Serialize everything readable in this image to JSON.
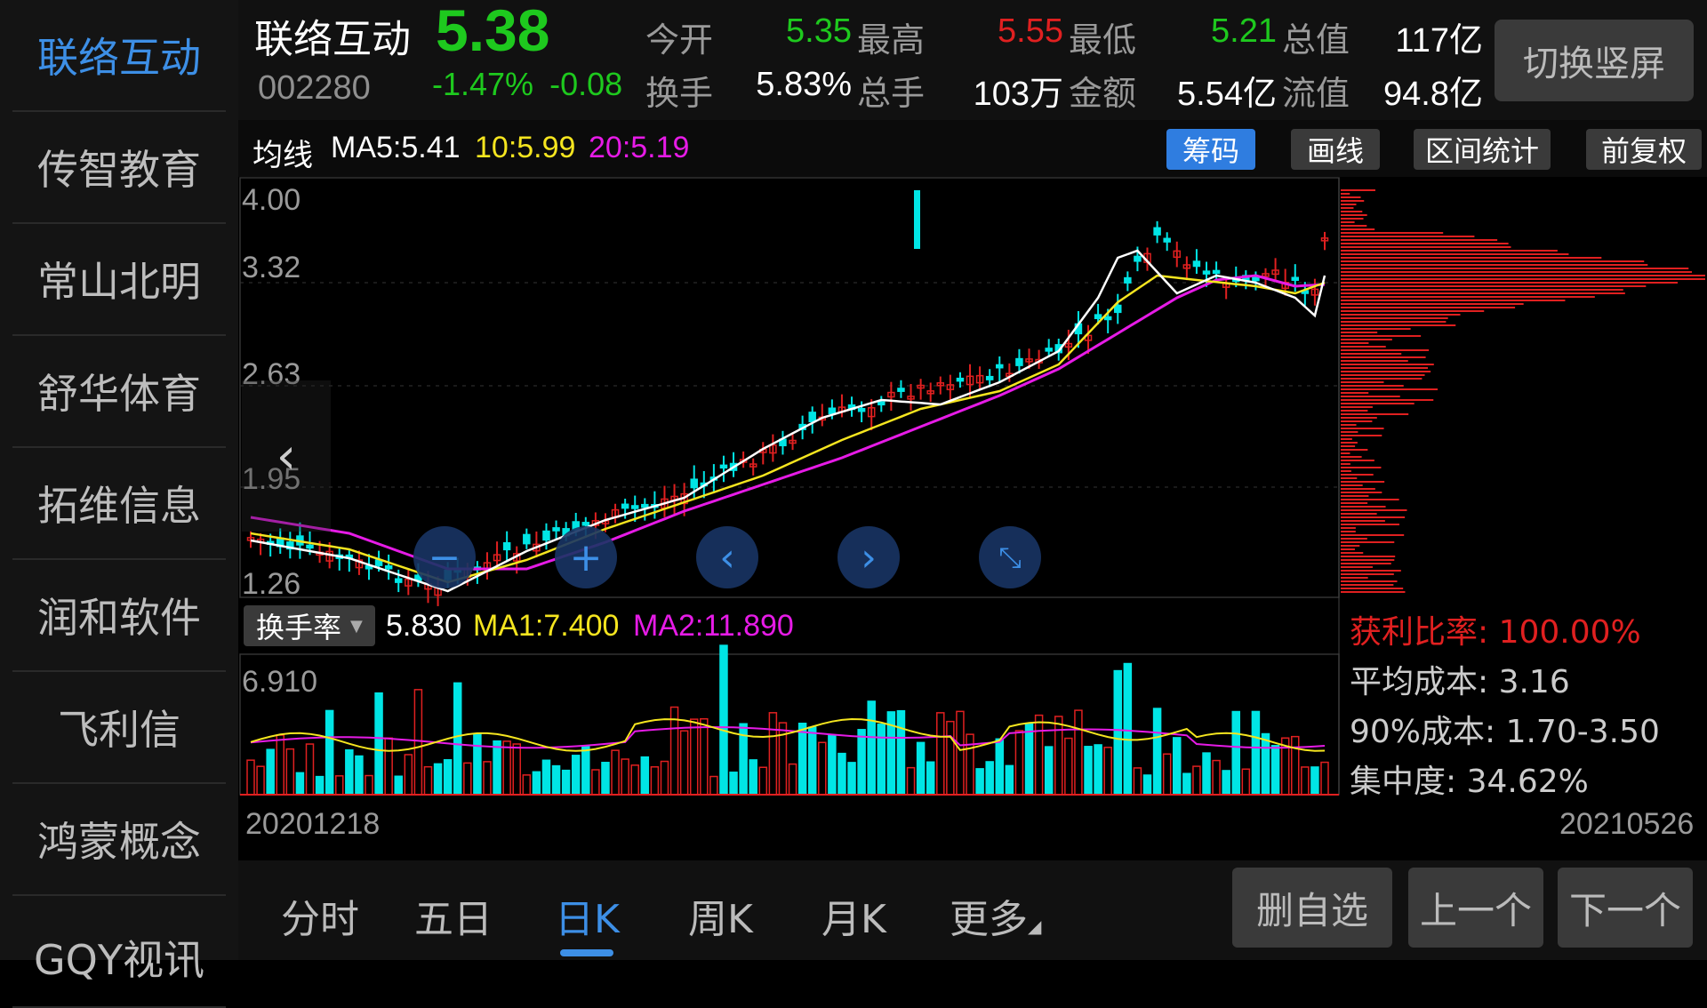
{
  "sidebar": {
    "items": [
      "联络互动",
      "传智教育",
      "常山北明",
      "舒华体育",
      "拓维信息",
      "润和软件",
      "飞利信",
      "鸿蒙概念",
      "GQY视讯"
    ],
    "active_index": 0
  },
  "header": {
    "name": "联络互动",
    "code": "002280",
    "price": "5.38",
    "change_pct": "-1.47%",
    "change_amt": "-0.08",
    "quotes": {
      "open_label": "今开",
      "open": "5.35",
      "high_label": "最高",
      "high": "5.55",
      "low_label": "最低",
      "low": "5.21",
      "total_value_label": "总值",
      "total_value": "117亿",
      "turnover_label": "换手",
      "turnover": "5.83%",
      "total_hands_label": "总手",
      "total_hands": "103万",
      "amount_label": "金额",
      "amount": "5.54亿",
      "float_value_label": "流值",
      "float_value": "94.8亿"
    },
    "switch_button": "切换竖屏"
  },
  "ma_bar": {
    "label": "均线",
    "ma5": "MA5:5.41",
    "ma10": "10:5.99",
    "ma20": "20:5.19",
    "buttons": {
      "chips": "筹码",
      "draw": "画线",
      "interval": "区间统计",
      "adjust": "前复权"
    }
  },
  "colors": {
    "up": "#e02020",
    "down": "#00e5e5",
    "green": "#1ec91e",
    "ma5": "#ffffff",
    "ma10": "#f5e51f",
    "ma20": "#e61be6",
    "accent": "#3d8fe6"
  },
  "chart_data": {
    "type": "candlestick",
    "price_axis_ticks": [
      "4.00",
      "3.32",
      "2.63",
      "1.95",
      "1.26"
    ],
    "price_ylim": [
      1.26,
      4.0
    ],
    "date_start": "20201218",
    "date_end": "20210526",
    "turnover_axis_top": "6.910"
  },
  "volume": {
    "indicator": "换手率",
    "value": "5.830",
    "ma1": "MA1:7.400",
    "ma2": "MA2:11.890"
  },
  "chips": {
    "profit_ratio": "获利比率: 100.00%",
    "avg_cost": "平均成本: 3.16",
    "cost90": "90%成本:  1.70-3.50",
    "concentration": "集中度: 34.62%"
  },
  "periods": [
    "分时",
    "五日",
    "日K",
    "周K",
    "月K",
    "更多"
  ],
  "active_period": "日K",
  "bottom_buttons": {
    "remove": "删自选",
    "prev": "上一个",
    "next": "下一个"
  },
  "nav_icons": [
    "zoom-out-icon",
    "zoom-in-icon",
    "chevron-left-icon",
    "chevron-right-icon",
    "collapse-icon"
  ]
}
